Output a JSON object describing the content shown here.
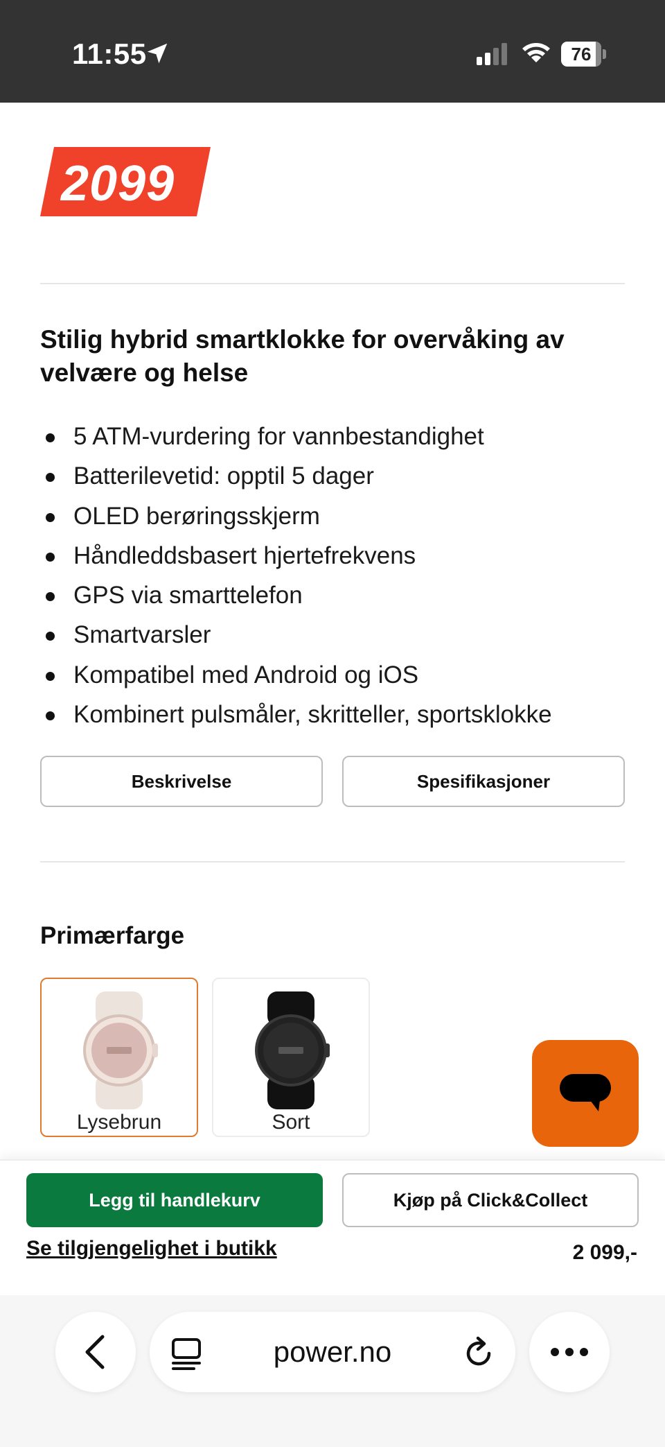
{
  "status_bar": {
    "time": "11:55",
    "battery": "76",
    "icons": [
      "location-arrow-icon",
      "signal-icon",
      "wifi-icon",
      "battery-icon"
    ]
  },
  "product": {
    "price_badge": "2099",
    "headline": "Stilig hybrid smartklokke for overvåking av velvære og helse",
    "features": [
      "5 ATM-vurdering for vannbestandighet",
      "Batterilevetid: opptil 5 dager",
      "OLED berøringsskjerm",
      "Håndleddsbasert hjertefrekvens",
      "GPS via smarttelefon",
      "Smartvarsler",
      "Kompatibel med Android og iOS",
      "Kombinert pulsmåler, skritteller, sportsklokke"
    ],
    "tabs": {
      "description": "Beskrivelse",
      "specifications": "Spesifikasjoner"
    }
  },
  "color_selector": {
    "title": "Primærfarge",
    "options": [
      {
        "label": "Lysebrun",
        "selected": true,
        "case_color": "#f1e4dd",
        "band_color": "#ece4dc"
      },
      {
        "label": "Sort",
        "selected": false,
        "case_color": "#222222",
        "band_color": "#111111"
      }
    ],
    "selected_border_color": "#e07a2e"
  },
  "buy_bar": {
    "add_to_cart": "Legg til handlekurv",
    "click_collect": "Kjøp på Click&Collect",
    "store_availability": "Se tilgjengelighet i butikk",
    "price": "2 099,-"
  },
  "browser": {
    "url": "power.no"
  },
  "colors": {
    "price_badge": "#f0412a",
    "add_to_cart": "#0a7a3e",
    "chat_button": "#e8650b",
    "status_bar": "#333333"
  }
}
